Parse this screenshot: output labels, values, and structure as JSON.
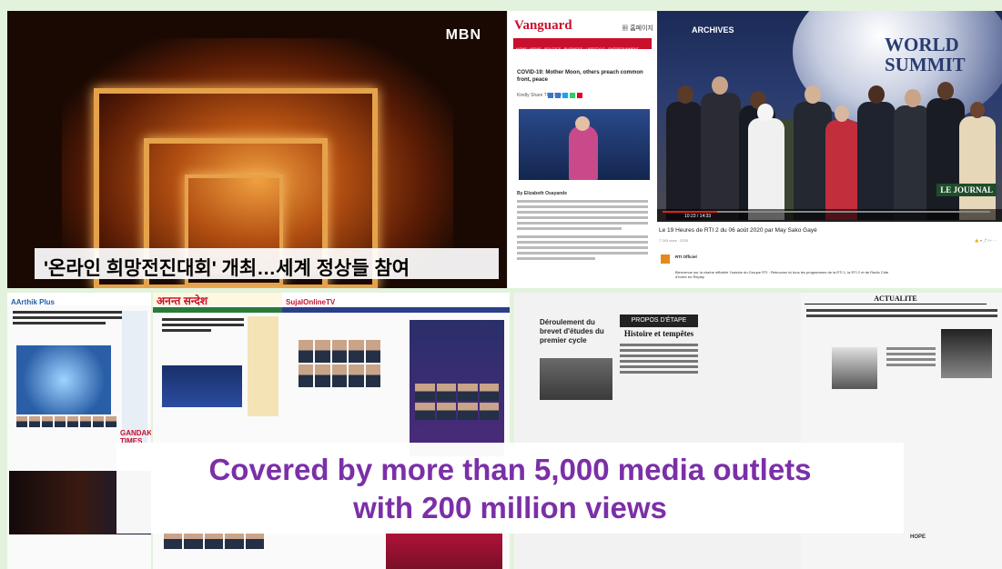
{
  "caption": {
    "line1": "Covered by more than 5,000 media outlets",
    "line2": "with 200 million views"
  },
  "mbn": {
    "logo": "MBN",
    "lower_third": "'온라인 희망전진대회' 개최…세계 정상들 참여"
  },
  "vanguard": {
    "logo": "Vanguard",
    "headline": "COVID-19: Mother Moon, others preach common front, peace",
    "share_label": "Kindly Share This Story:",
    "byline": "By Elizabeth Osayande"
  },
  "world_summit": {
    "badge": "ARCHIVES",
    "banner": "WORLD SUMMIT",
    "overlay_label": "LE JOURNAL",
    "video_time": "10:23 / 14:33",
    "video_title": "Le 19 Heures de RTI 2 du 06 août 2020 par May Sako Gayé",
    "channel": "RTI Officiel",
    "description": "Bienvenue sur la chaîne officielle Youtube du Groupe RTI : Retrouvez ici tous les programmes de la RTI 1, la RTI 2 et de Radio Côte d'Ivoire en Replay"
  },
  "collage": {
    "n1_header": "AArthik Plus",
    "n1_footer": "GANDAKI TIMES",
    "n2_header": "अनन्त सन्देश",
    "n3_header": "SujalOnlineTV",
    "n4_header": "PROPOS D'ÉTAPE",
    "n4_title": "Histoire et tempêtes",
    "n4_left_title": "Déroulement du brevet d'études du premier cycle",
    "n5_header": "ACTUALITE",
    "n5_sub": "HOPE"
  }
}
